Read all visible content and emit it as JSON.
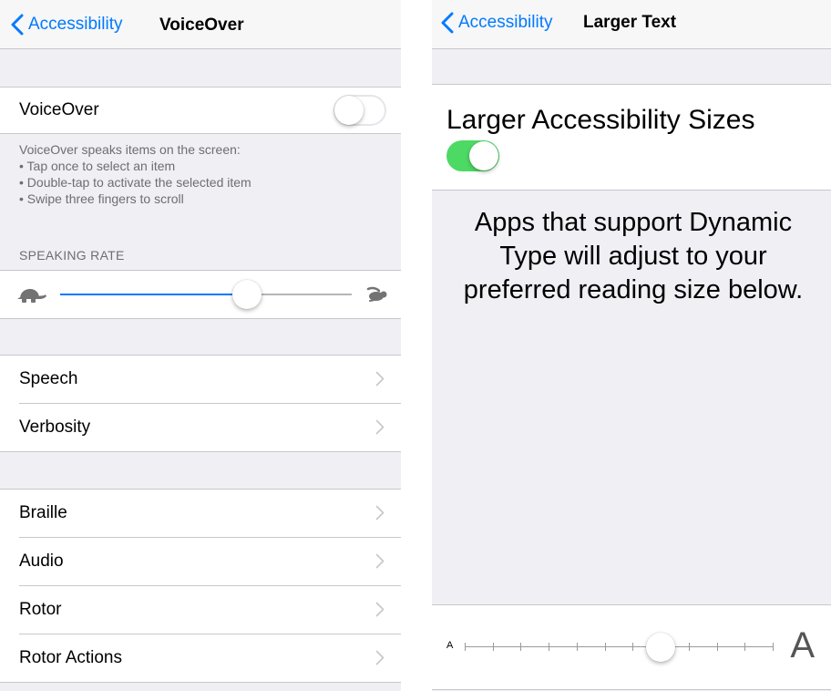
{
  "voiceover_screen": {
    "back_label": "Accessibility",
    "title": "VoiceOver",
    "toggle_label": "VoiceOver",
    "toggle_on": false,
    "footer_title": "VoiceOver speaks items on the screen:",
    "footer_bullets": [
      "• Tap once to select an item",
      "• Double-tap to activate the selected item",
      "• Swipe three fingers to scroll"
    ],
    "speaking_rate_header": "SPEAKING RATE",
    "speaking_rate_value": 0.66,
    "group1": [
      "Speech",
      "Verbosity"
    ],
    "group2": [
      "Braille",
      "Audio",
      "Rotor",
      "Rotor Actions"
    ]
  },
  "larger_text_screen": {
    "back_label": "Accessibility",
    "title": "Larger Text",
    "toggle_label": "Larger Accessibility Sizes",
    "toggle_on": true,
    "description": "Apps that support Dynamic Type will adjust to your preferred reading size below.",
    "small_a": "A",
    "large_a": "A",
    "text_size_step": 7,
    "text_size_steps": 12
  },
  "colors": {
    "ios_blue": "#007aff",
    "switch_green": "#4cd964",
    "group_background": "#efeff4",
    "separator": "#c8c7cc"
  }
}
